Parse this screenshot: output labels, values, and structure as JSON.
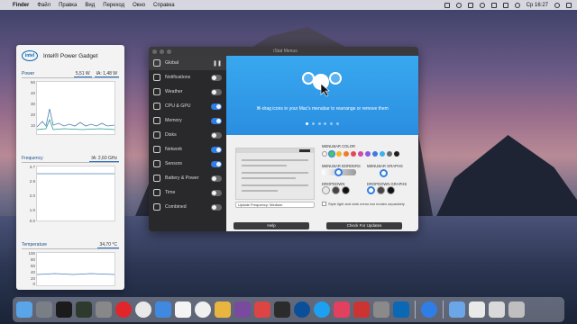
{
  "menubar": {
    "items": [
      "Finder",
      "Файл",
      "Правка",
      "Вид",
      "Переход",
      "Окно",
      "Справка"
    ],
    "clock": "Ср 16:27"
  },
  "power_gadget": {
    "title": "Intel® Power Gadget",
    "logo": "intel",
    "power": {
      "label": "Power",
      "value1": "5,51 W",
      "value2": "IA: 1,48 W",
      "ticks": [
        "50",
        "40",
        "30",
        "20",
        "10",
        "0"
      ]
    },
    "frequency": {
      "label": "Frequency",
      "value": "IA: 2,60 GHz",
      "ticks": [
        "3.7",
        "2.9",
        "2.0",
        "1.0",
        "0.0"
      ]
    },
    "temperature": {
      "label": "Temperature",
      "value": "34,70 °C",
      "ticks": [
        "100",
        "80",
        "60",
        "40",
        "20",
        "0"
      ]
    }
  },
  "istat": {
    "title": "iStat Menus",
    "sidebar": [
      {
        "label": "Global",
        "icon": "gear-icon",
        "state": "pause"
      },
      {
        "label": "Notifications",
        "icon": "bell-icon",
        "state": "off"
      },
      {
        "label": "Weather",
        "icon": "cloud-icon",
        "state": "off"
      },
      {
        "label": "CPU & GPU",
        "icon": "cpu-icon",
        "state": "on"
      },
      {
        "label": "Memory",
        "icon": "memory-icon",
        "state": "on"
      },
      {
        "label": "Disks",
        "icon": "disk-icon",
        "state": "off"
      },
      {
        "label": "Network",
        "icon": "network-icon",
        "state": "on"
      },
      {
        "label": "Sensors",
        "icon": "sensor-icon",
        "state": "on"
      },
      {
        "label": "Battery & Power",
        "icon": "battery-icon",
        "state": "off"
      },
      {
        "label": "Time",
        "icon": "clock-icon",
        "state": "off"
      },
      {
        "label": "Combined",
        "icon": "combined-icon",
        "state": "off"
      }
    ],
    "hero_text": "⌘-drag icons in your Mac's menubar to rearrange or remove them",
    "menubar_color_label": "MENUBAR COLOR",
    "menubar_borders_label": "MENUBAR BORDERS",
    "menubar_graphs_label": "MENUBAR GRAPHS",
    "dropdown_label": "DROPDOWN",
    "dropdown_graphs_label": "DROPDOWN GRAPHS",
    "update_frequency": "Update Frequency: Medium",
    "style_checkbox": "Style light and dark menu bar modes separately",
    "help_button": "Help",
    "updates_button": "Check For Updates",
    "swatch_colors": [
      "#f5f5f5",
      "#4ac36a",
      "#f7b32b",
      "#f07a2a",
      "#e4475a",
      "#d24aa5",
      "#8a5cd6",
      "#3a7be3",
      "#3bb2ef",
      "#6b6b6b",
      "#1e1e1e"
    ]
  },
  "dock_apps": [
    "finder-icon",
    "launchpad-icon",
    "terminal-icon",
    "activity-monitor-icon",
    "utility-icon",
    "opera-icon",
    "chrome-icon",
    "mail-icon",
    "calendar-icon",
    "itunes-icon",
    "photos-icon",
    "rar-icon",
    "gallery-icon",
    "movies-icon",
    "imo-icon",
    "skype-icon",
    "itunes-store-icon",
    "flag-icon",
    "settings-icon",
    "intel-icon",
    "istat-icon",
    "folder-icon",
    "folder-icon-2",
    "folder-icon-3",
    "trash-icon"
  ]
}
